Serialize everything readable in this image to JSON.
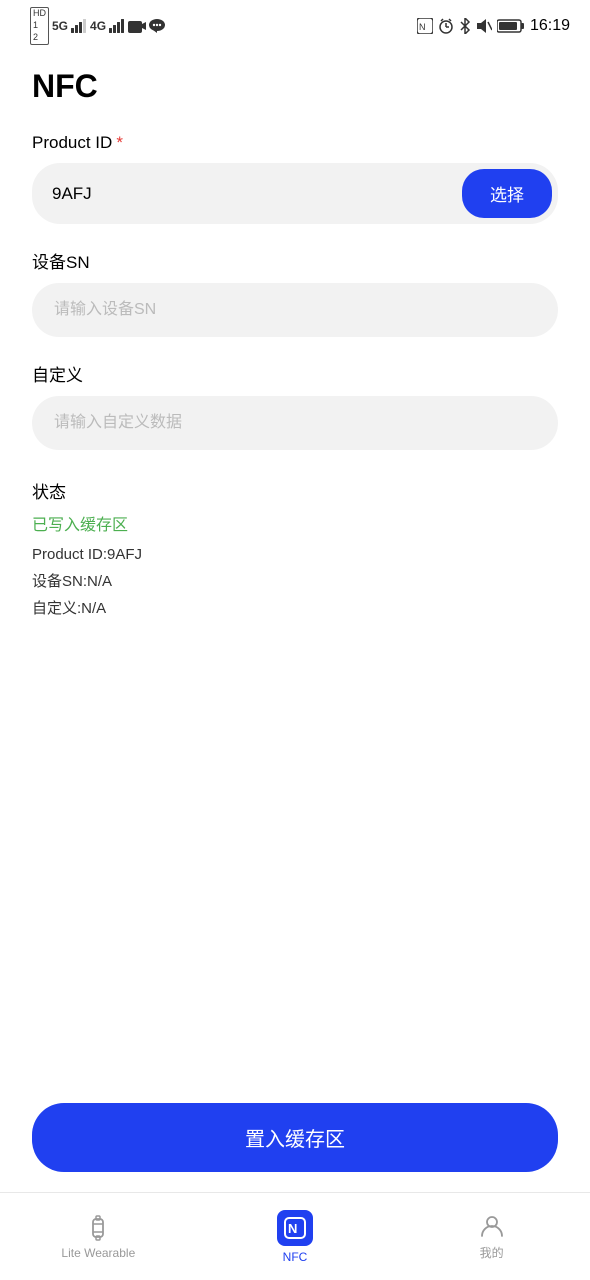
{
  "statusBar": {
    "time": "16:19",
    "network": "5G",
    "signal": "4G"
  },
  "page": {
    "title": "NFC"
  },
  "productId": {
    "label": "Product ID",
    "required": "*",
    "value": "9AFJ",
    "selectBtn": "选择"
  },
  "deviceSN": {
    "label": "设备SN",
    "placeholder": "请输入设备SN"
  },
  "custom": {
    "label": "自定义",
    "placeholder": "请输入自定义数据"
  },
  "status": {
    "label": "状态",
    "successText": "已写入缓存区",
    "productIdDetail": "Product ID:9AFJ",
    "deviceSNDetail": "设备SN:N/A",
    "customDetail": "自定义:N/A"
  },
  "actionBtn": "置入缓存区",
  "bottomNav": {
    "items": [
      {
        "id": "lite-wearable",
        "label": "Lite Wearable",
        "active": false
      },
      {
        "id": "nfc",
        "label": "NFC",
        "active": true
      },
      {
        "id": "mine",
        "label": "我的",
        "active": false
      }
    ]
  }
}
